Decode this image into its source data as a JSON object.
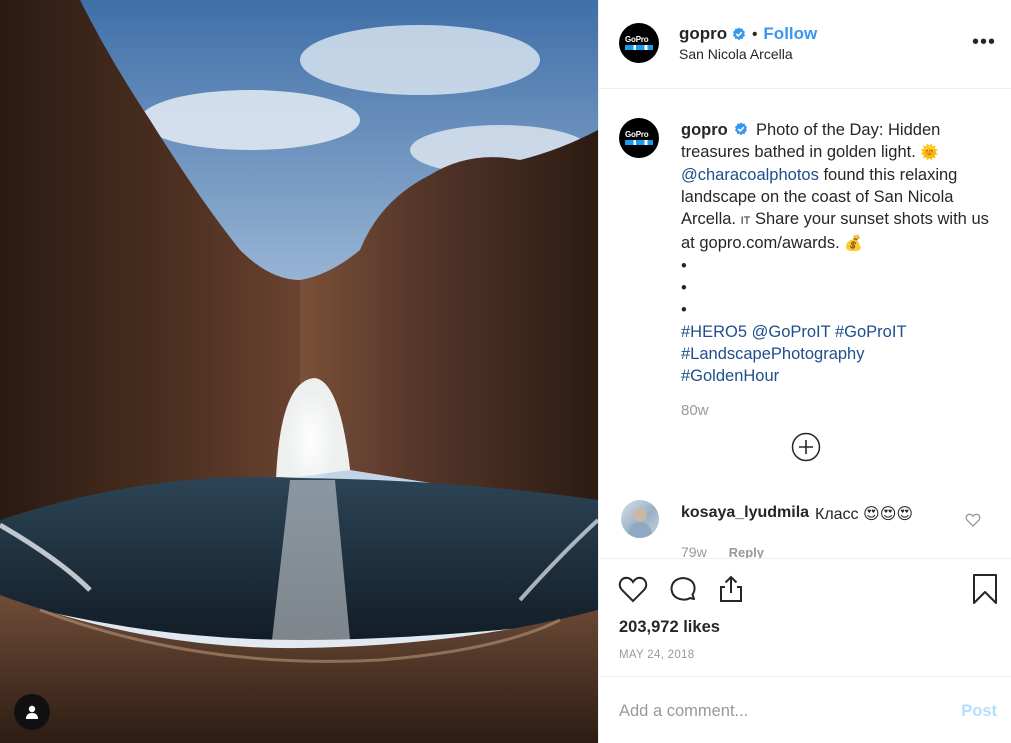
{
  "post": {
    "username": "gopro",
    "follow_label": "Follow",
    "separator": "•",
    "location": "San Nicola Arcella",
    "more_label": "•••",
    "avatar_logo_text": "GoPro"
  },
  "caption": {
    "username": "gopro",
    "text_1": "Photo of the Day: Hidden treasures bathed in golden light.",
    "emoji_sun": "🌞",
    "mention": "@characoalphotos",
    "text_2": "found this relaxing landscape on the coast of San Nicola Arcella.",
    "flag_text": "IT",
    "text_3": "Share your sunset shots with us at gopro.com/awards.",
    "emoji_money": "💰",
    "bullets": [
      "•",
      "•",
      "•"
    ],
    "hashtags_line1": "#HERO5 @GoProIT #GoProIT",
    "hashtags_line2": "#LandscapePhotography",
    "hashtags_line3": "#GoldenHour",
    "age": "80w"
  },
  "comment": {
    "username": "kosaya_lyudmila",
    "text": "Класс",
    "emojis": "😍😍😍",
    "age": "79w",
    "reply_label": "Reply"
  },
  "stats": {
    "likes": "203,972 likes",
    "date": "MAY 24, 2018"
  },
  "composer": {
    "placeholder": "Add a comment...",
    "post_label": "Post"
  },
  "colors": {
    "link_blue": "#3897f0",
    "hashtag_blue": "#1f4e8c",
    "muted": "#999999",
    "post_disabled": "#b2dffc",
    "verified_blue": "#3897f0"
  },
  "icons": [
    "heart-icon",
    "comment-icon",
    "share-icon",
    "bookmark-icon",
    "add-icon",
    "verified-icon",
    "user-tag-icon",
    "more-icon"
  ]
}
